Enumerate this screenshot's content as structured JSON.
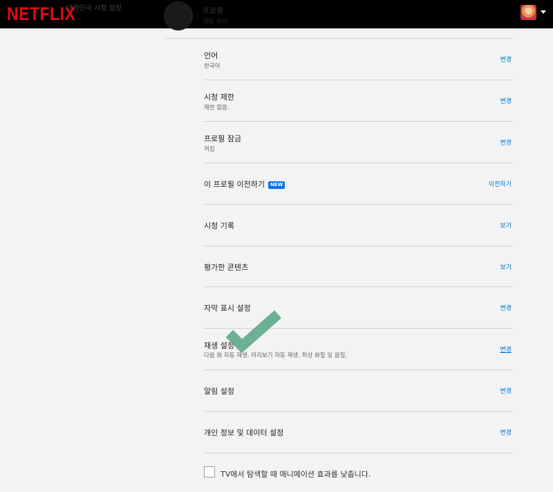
{
  "header": {
    "logo": "NETFLIX",
    "faded_label": "대한민국 시청 설정",
    "profile_name": "프로필",
    "profile_sub": "계정 관리"
  },
  "settings": [
    {
      "title": "언어",
      "sub": "한국어",
      "action": "변경"
    },
    {
      "title": "시청 제한",
      "sub": "제한 없음.",
      "action": "변경"
    },
    {
      "title": "프로필 잠금",
      "sub": "꺼짐",
      "action": "변경"
    },
    {
      "title": "이 프로필 이전하기",
      "badge": "NEW",
      "action": "이전하기"
    },
    {
      "title": "시청 기록",
      "action": "보기"
    },
    {
      "title": "평가한 콘텐츠",
      "action": "보기"
    },
    {
      "title": "자막 표시 설정",
      "action": "변경"
    },
    {
      "title": "재생 설정",
      "sub": "다음 화 자동 재생. 미리보기 자동 재생. 최상 화질 및 음질.",
      "action": "변경"
    },
    {
      "title": "알림 설정",
      "action": "변경"
    },
    {
      "title": "개인 정보 및 데이터 설정",
      "action": "변경"
    }
  ],
  "reduce_animation": {
    "label": "TV에서 탐색할 때 애니메이션 효과를 낮춥니다.",
    "checked": false
  },
  "colors": {
    "accent": "#0073c9",
    "brand": "#e50914",
    "checkmark": "#5ea88a"
  }
}
